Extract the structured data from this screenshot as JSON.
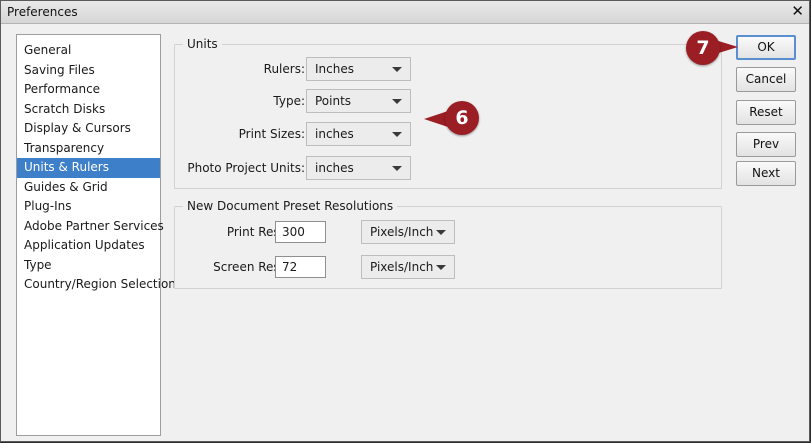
{
  "window": {
    "title": "Preferences",
    "close_glyph": "✕"
  },
  "sidebar": {
    "items": [
      {
        "label": "General"
      },
      {
        "label": "Saving Files"
      },
      {
        "label": "Performance"
      },
      {
        "label": "Scratch Disks"
      },
      {
        "label": "Display & Cursors"
      },
      {
        "label": "Transparency"
      },
      {
        "label": "Units & Rulers",
        "selected": true
      },
      {
        "label": "Guides & Grid"
      },
      {
        "label": "Plug-Ins"
      },
      {
        "label": "Adobe Partner Services"
      },
      {
        "label": "Application Updates"
      },
      {
        "label": "Type"
      },
      {
        "label": "Country/Region Selection"
      }
    ]
  },
  "units": {
    "legend": "Units",
    "rulers_label": "Rulers:",
    "rulers_value": "Inches",
    "type_label": "Type:",
    "type_value": "Points",
    "print_sizes_label": "Print Sizes:",
    "print_sizes_value": "inches",
    "photo_project_label": "Photo Project Units:",
    "photo_project_value": "inches"
  },
  "resolutions": {
    "legend": "New Document Preset Resolutions",
    "print_label": "Print Resolution:",
    "print_value": "300",
    "print_unit": "Pixels/Inch",
    "screen_label": "Screen Resolution:",
    "screen_value": "72",
    "screen_unit": "Pixels/Inch"
  },
  "buttons": {
    "ok": "OK",
    "cancel": "Cancel",
    "reset": "Reset",
    "prev": "Prev",
    "next": "Next"
  },
  "callouts": {
    "six": "6",
    "seven": "7",
    "color": "#9b1e25"
  },
  "colors": {
    "selection": "#3e7fca",
    "default_button_border": "#5a8fcf"
  }
}
